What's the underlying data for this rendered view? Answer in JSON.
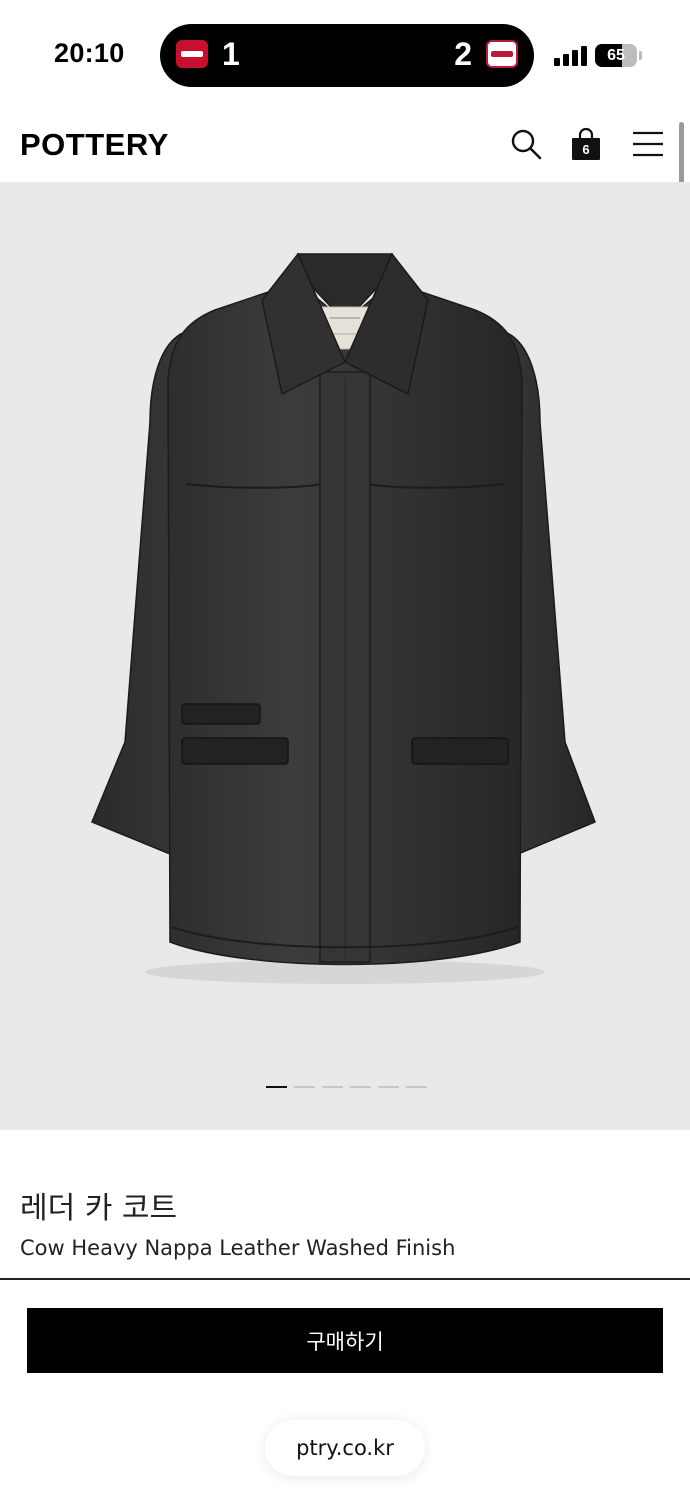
{
  "status_bar": {
    "time": "20:10",
    "live_activity": {
      "home_team_icon": "tigers-logo-icon",
      "home_score": "1",
      "away_score": "2",
      "away_team_icon": "twins-logo-icon"
    },
    "signal_icon": "cellular-signal-icon",
    "battery_level": "65",
    "battery_fraction": 0.65
  },
  "header": {
    "logo": "POTTERY",
    "search_icon": "search-icon",
    "bag_icon": "shopping-bag-icon",
    "bag_count": "6",
    "menu_icon": "hamburger-menu-icon"
  },
  "gallery": {
    "image": "black leather car coat product photo",
    "total_images": 6,
    "active_index": 0
  },
  "product": {
    "name_ko": "레더 카 코트",
    "name_en": "Cow Heavy Nappa Leather Washed Finish"
  },
  "actions": {
    "buy_label": "구매하기"
  },
  "browser": {
    "url": "ptry.co.kr"
  },
  "colors": {
    "accent": "#000000",
    "gallery_bg": "#e9e9e9",
    "coat": "#2b2b2b"
  }
}
